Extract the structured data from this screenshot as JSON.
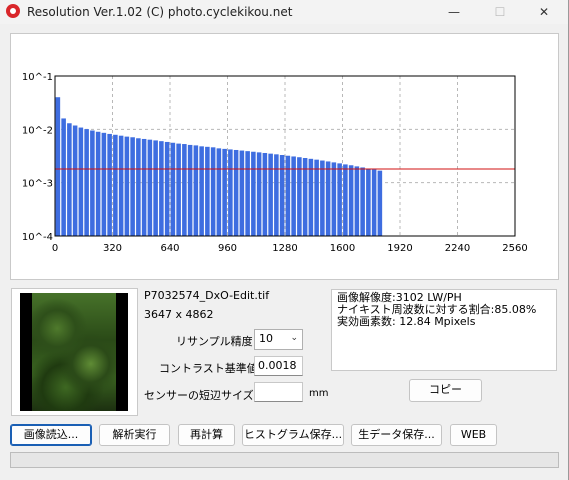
{
  "window": {
    "title": "Resolution Ver.1.02 (C) photo.cyclekikou.net",
    "minimize_glyph": "—",
    "maximize_glyph": "☐",
    "close_glyph": "✕"
  },
  "chart_data": {
    "type": "bar",
    "x_ticks": [
      "0",
      "320",
      "640",
      "960",
      "1280",
      "1600",
      "1920",
      "2240",
      "2560"
    ],
    "y_ticks": [
      "10^-1",
      "10^-2",
      "10^-3",
      "10^-4"
    ],
    "xlim": [
      0,
      2560
    ],
    "ylim": [
      0.0001,
      0.1
    ],
    "yscale": "log",
    "grid": true,
    "bar_color": "#3e6de0",
    "threshold_color": "#d01010",
    "threshold": 0.0018,
    "bin_width": 32,
    "x": [
      0,
      32,
      64,
      96,
      128,
      160,
      192,
      224,
      256,
      288,
      320,
      352,
      384,
      416,
      448,
      480,
      512,
      544,
      576,
      608,
      640,
      672,
      704,
      736,
      768,
      800,
      832,
      864,
      896,
      928,
      960,
      992,
      1024,
      1056,
      1088,
      1120,
      1152,
      1184,
      1216,
      1248,
      1280,
      1312,
      1344,
      1376,
      1408,
      1440,
      1472,
      1504,
      1536,
      1568,
      1600,
      1632,
      1664,
      1696,
      1728,
      1760,
      1792
    ],
    "values": [
      0.04,
      0.016,
      0.013,
      0.0118,
      0.0108,
      0.0101,
      0.0095,
      0.009,
      0.0086,
      0.0082,
      0.0079,
      0.0076,
      0.0073,
      0.0071,
      0.0068,
      0.0066,
      0.0064,
      0.0062,
      0.006,
      0.0058,
      0.0056,
      0.0054,
      0.0053,
      0.0051,
      0.005,
      0.0048,
      0.0047,
      0.0046,
      0.0044,
      0.0043,
      0.0042,
      0.0041,
      0.004,
      0.0039,
      0.0038,
      0.0037,
      0.0036,
      0.0035,
      0.0034,
      0.0033,
      0.0032,
      0.0031,
      0.003,
      0.0029,
      0.0028,
      0.0027,
      0.0026,
      0.0025,
      0.0024,
      0.0023,
      0.0022,
      0.00212,
      0.00202,
      0.00193,
      0.00184,
      0.00176,
      0.00168
    ]
  },
  "file": {
    "name": "P7032574_DxO-Edit.tif",
    "dimensions": "3647 x 4862"
  },
  "settings": {
    "resample_label": "リサンプル精度",
    "resample_value": "10",
    "contrast_label": "コントラスト基準値",
    "contrast_value": "0.0018",
    "sensor_label": "センサーの短辺サイズ",
    "sensor_value": "",
    "sensor_unit": "mm"
  },
  "results": {
    "line1": "画像解像度:3102 LW/PH",
    "line2": "ナイキスト周波数に対する割合:85.08%",
    "line3": "実効画素数: 12.84 Mpixels"
  },
  "buttons": {
    "copy": "コピー",
    "load_image": "画像読込...",
    "analyze": "解析実行",
    "recalc": "再計算",
    "save_histogram": "ヒストグラム保存...",
    "save_raw": "生データ保存...",
    "web": "WEB"
  },
  "progress": {
    "fraction": 0
  }
}
